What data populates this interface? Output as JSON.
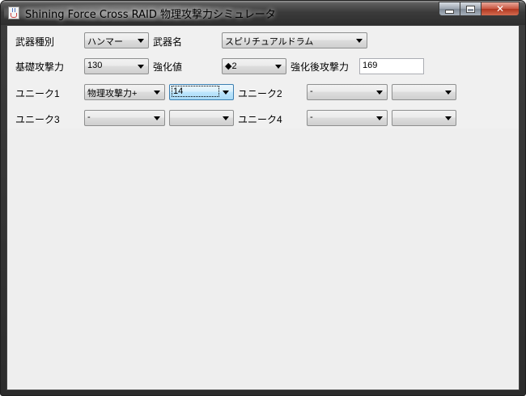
{
  "window": {
    "title": "Shining Force Cross RAID 物理攻撃力シミュレータ",
    "controls": {
      "minimize": "_",
      "maximize": "□",
      "close": "✕"
    }
  },
  "form": {
    "weapon_type": {
      "label": "武器種別",
      "value": "ハンマー"
    },
    "weapon_name": {
      "label": "武器名",
      "value": "スピリチュアルドラム"
    },
    "base_attack": {
      "label": "基礎攻撃力",
      "value": "130"
    },
    "enhance": {
      "label": "強化値",
      "value": "◆2"
    },
    "enhanced_attack": {
      "label": "強化後攻撃力",
      "value": "169"
    },
    "unique1": {
      "label": "ユニーク1",
      "type": "物理攻撃力+",
      "amount": "14"
    },
    "unique2": {
      "label": "ユニーク2",
      "type": "-",
      "amount": ""
    },
    "unique3": {
      "label": "ユニーク3",
      "type": "-",
      "amount": ""
    },
    "unique4": {
      "label": "ユニーク4",
      "type": "-",
      "amount": ""
    }
  }
}
